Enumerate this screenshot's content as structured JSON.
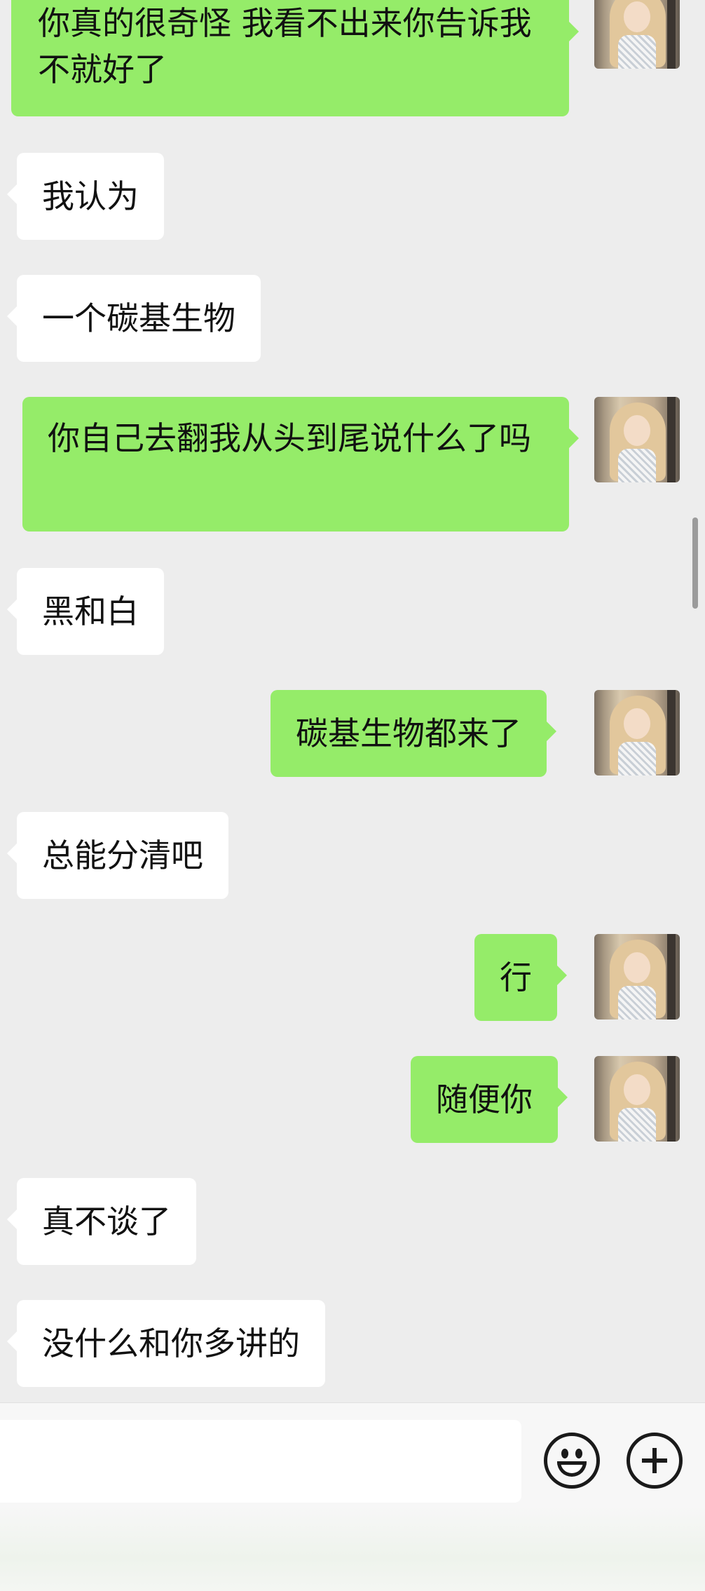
{
  "messages": [
    {
      "side": "out",
      "text": "你真的很奇怪 我看不出来你告诉我不就好了"
    },
    {
      "side": "in",
      "text": "我认为"
    },
    {
      "side": "in",
      "text": "一个碳基生物"
    },
    {
      "side": "out",
      "text": "你自己去翻我从头到尾说什么了吗"
    },
    {
      "side": "in",
      "text": "黑和白"
    },
    {
      "side": "out",
      "text": "碳基生物都来了"
    },
    {
      "side": "in",
      "text": "总能分清吧"
    },
    {
      "side": "out",
      "text": "行"
    },
    {
      "side": "out",
      "text": "随便你"
    },
    {
      "side": "in",
      "text": "真不谈了"
    },
    {
      "side": "in",
      "text": "没什么和你多讲的"
    }
  ],
  "input": {
    "placeholder": "",
    "value": ""
  },
  "icons": {
    "emoji": "smiley-face-icon",
    "more": "plus-circle-icon"
  },
  "colors": {
    "outgoing_bubble": "#95EC69",
    "incoming_bubble": "#FFFFFF",
    "background": "#EDEDED"
  }
}
